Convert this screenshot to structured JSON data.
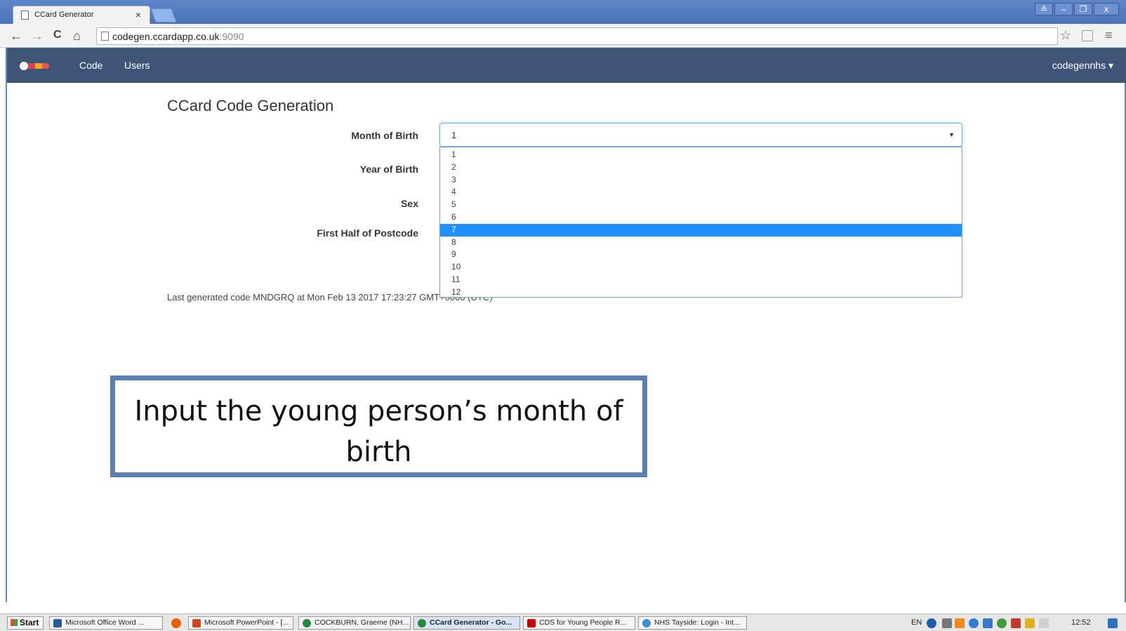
{
  "browser": {
    "tab_title": "CCard Generator",
    "tab_close": "×",
    "window_buttons": [
      "≗",
      "–",
      "❐",
      "x"
    ],
    "back_icon": "←",
    "forward_icon": "→",
    "reload_icon": "C",
    "home_icon": "⌂",
    "url_host": "codegen.ccardapp.co.uk",
    "url_port": ":9090",
    "star_icon": "☆",
    "menu_icon": "≡"
  },
  "app_nav": {
    "links": [
      "Code",
      "Users"
    ],
    "user_menu": "codegennhs ▾"
  },
  "form": {
    "heading": "CCard Code Generation",
    "labels": {
      "month": "Month of Birth",
      "year": "Year of Birth",
      "sex": "Sex",
      "postcode": "First Half of Postcode"
    },
    "month_selected": "1",
    "month_caret": "▼",
    "month_options": [
      "1",
      "2",
      "3",
      "4",
      "5",
      "6",
      "7",
      "8",
      "9",
      "10",
      "11",
      "12"
    ],
    "highlighted_option": "7",
    "last_generated": "Last generated code MNDGRQ at Mon Feb 13 2017 17:23:27 GMT+0000 (UTC)"
  },
  "callout": {
    "line1": "Input the young person’s month of",
    "line2": "birth"
  },
  "taskbar": {
    "start": "Start",
    "items": [
      "Microsoft Office Word ...",
      "Microsoft PowerPoint - [...",
      "COCKBURN, Graeme (NH...",
      "CCard Generator - Go...",
      "CDS for Young People R...",
      "NHS Tayside: Login - Int..."
    ],
    "active_item": "CCard Generator - Go...",
    "language": "EN",
    "clock": "12:52"
  }
}
